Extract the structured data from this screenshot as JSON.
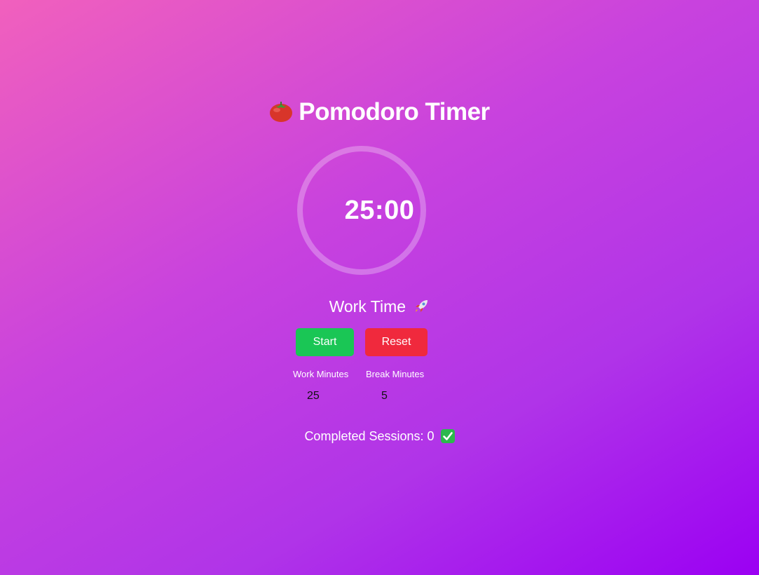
{
  "app": {
    "title": "Pomodoro Timer",
    "title_icon": "tomato-icon"
  },
  "timer": {
    "display": "25:00",
    "mode_label": "Work Time",
    "mode_icon": "rocket-icon"
  },
  "controls": {
    "start_label": "Start",
    "reset_label": "Reset",
    "start_color": "#1ac655",
    "reset_color": "#f0293d"
  },
  "settings": {
    "work_label": "Work Minutes",
    "work_value": "25",
    "break_label": "Break Minutes",
    "break_value": "5"
  },
  "sessions": {
    "text": "Completed Sessions: 0",
    "icon": "check-mark-icon"
  },
  "colors": {
    "gradient_start": "#f160bd",
    "gradient_end": "#9b00f3"
  }
}
